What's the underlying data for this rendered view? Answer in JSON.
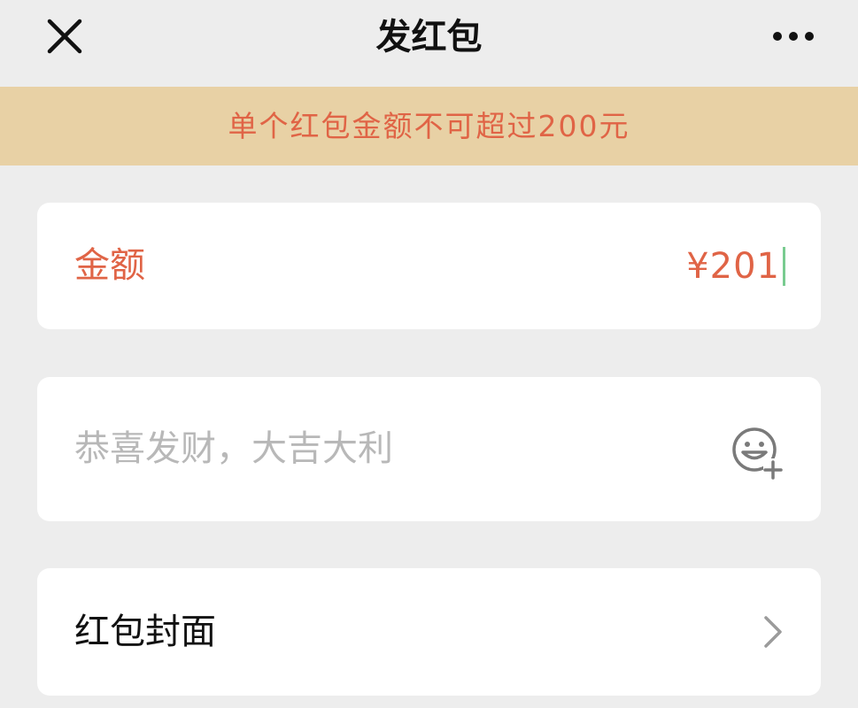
{
  "header": {
    "title": "发红包",
    "close_icon": "close-icon",
    "more_icon": "more-dots-icon"
  },
  "banner": {
    "text": "单个红包金额不可超过200元"
  },
  "amount": {
    "label": "金额",
    "value": "¥201"
  },
  "greeting": {
    "placeholder": "恭喜发财，大吉大利",
    "emoji_icon": "emoji-add-icon"
  },
  "cover": {
    "label": "红包封面",
    "chevron_icon": "chevron-right-icon"
  },
  "colors": {
    "background": "#ededed",
    "banner_bg": "#e8d1a5",
    "accent_red": "#e06446",
    "placeholder": "#b8b8b8",
    "caret": "#62c27c"
  }
}
